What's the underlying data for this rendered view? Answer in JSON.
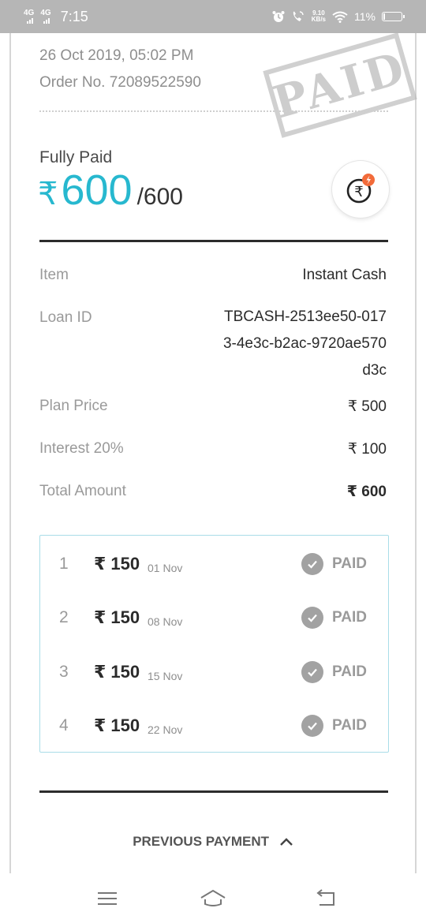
{
  "status_bar": {
    "network1": "4G",
    "network2": "4G",
    "time": "7:15",
    "speed_value": "9.10",
    "speed_unit": "KB/s",
    "battery_percent": "11%",
    "battery_level": 0.11
  },
  "order": {
    "date": "26 Oct 2019, 05:02 PM",
    "number": "Order No. 72089522590",
    "stamp": "PAID"
  },
  "summary": {
    "status": "Fully Paid",
    "currency": "₹",
    "paid": "600",
    "total": "/600",
    "icon": "rupee-flash-icon"
  },
  "details": [
    {
      "label": "Item",
      "value": "Instant Cash"
    },
    {
      "label": "Loan ID",
      "value": "TBCASH-2513ee50-0173-4e3c-b2ac-9720ae570d3c"
    },
    {
      "label": "Plan Price",
      "value": "₹ 500"
    },
    {
      "label": "Interest 20%",
      "value": "₹ 100"
    },
    {
      "label": "Total Amount",
      "value": "₹ 600"
    }
  ],
  "installments": [
    {
      "index": "1",
      "amount": "₹ 150",
      "date": "01 Nov",
      "status": "PAID"
    },
    {
      "index": "2",
      "amount": "₹ 150",
      "date": "08 Nov",
      "status": "PAID"
    },
    {
      "index": "3",
      "amount": "₹ 150",
      "date": "15 Nov",
      "status": "PAID"
    },
    {
      "index": "4",
      "amount": "₹ 150",
      "date": "22 Nov",
      "status": "PAID"
    }
  ],
  "previous_payment": {
    "label": "PREVIOUS PAYMENT",
    "icon": "chevron-up-icon"
  },
  "colors": {
    "accent": "#27b8cf",
    "border_accent": "#a9dde8",
    "alert": "#f26b3a"
  }
}
